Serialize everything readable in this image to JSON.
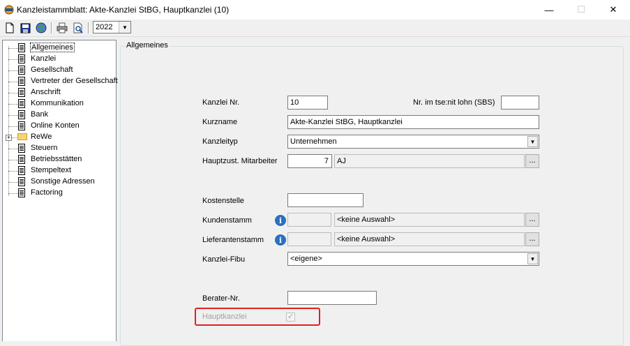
{
  "window": {
    "title": "Kanzleistammblatt: Akte-Kanzlei StBG, Hauptkanzlei (10)",
    "minimize": "—",
    "maximize": "☐",
    "close": "✕"
  },
  "toolbar": {
    "icons": [
      "new-document-icon",
      "save-icon",
      "globe-icon",
      "print-icon",
      "print-preview-icon"
    ],
    "year_value": "2022"
  },
  "tree": {
    "items": [
      {
        "label": "Allgemeines",
        "icon": "document-icon",
        "selected": true
      },
      {
        "label": "Kanzlei",
        "icon": "document-icon"
      },
      {
        "label": "Gesellschaft",
        "icon": "document-icon"
      },
      {
        "label": "Vertreter der Gesellschaft",
        "icon": "document-icon"
      },
      {
        "label": "Anschrift",
        "icon": "document-icon"
      },
      {
        "label": "Kommunikation",
        "icon": "document-icon"
      },
      {
        "label": "Bank",
        "icon": "document-icon"
      },
      {
        "label": "Online Konten",
        "icon": "document-icon"
      },
      {
        "label": "ReWe",
        "icon": "folder-icon",
        "expandable": true
      },
      {
        "label": "Steuern",
        "icon": "document-icon"
      },
      {
        "label": "Betriebsstätten",
        "icon": "document-icon"
      },
      {
        "label": "Stempeltext",
        "icon": "document-icon"
      },
      {
        "label": "Sonstige Adressen",
        "icon": "document-icon"
      },
      {
        "label": "Factoring",
        "icon": "document-icon"
      }
    ],
    "expander": "+"
  },
  "form": {
    "group_title": "Allgemeines",
    "kanzlei_nr_label": "Kanzlei Nr.",
    "kanzlei_nr_value": "10",
    "nr_tse_label": "Nr. im tse:nit lohn (SBS)",
    "nr_tse_value": "",
    "kurzname_label": "Kurzname",
    "kurzname_value": "Akte-Kanzlei StBG, Hauptkanzlei",
    "kanzleityp_label": "Kanzleityp",
    "kanzleityp_value": "Unternehmen",
    "hauptzust_label": "Hauptzust. Mitarbeiter",
    "hauptzust_nr": "7",
    "hauptzust_name": "AJ",
    "kostenstelle_label": "Kostenstelle",
    "kostenstelle_value": "",
    "kundenstamm_label": "Kundenstamm",
    "kundenstamm_value": "<keine Auswahl>",
    "lieferantenstamm_label": "Lieferantenstamm",
    "lieferantenstamm_value": "<keine Auswahl>",
    "kanzlei_fibu_label": "Kanzlei-Fibu",
    "kanzlei_fibu_value": "<eigene>",
    "berater_nr_label": "Berater-Nr.",
    "berater_nr_value": "",
    "hauptkanzlei_label": "Hauptkanzlei",
    "hauptkanzlei_checked": true,
    "ellipsis": "...",
    "info_glyph": "i",
    "dropdown_arrow": "▼",
    "checkmark": "✓"
  },
  "colors": {
    "highlight": "#e02020",
    "info": "#2b6fc2"
  }
}
